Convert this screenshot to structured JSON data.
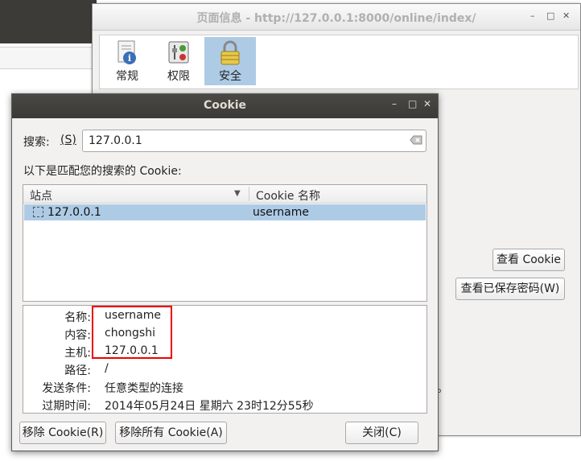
{
  "pageinfo": {
    "title": "页面信息 - http://127.0.0.1:8000/online/index/",
    "tabs": [
      {
        "label": "常规",
        "icon": "info-icon"
      },
      {
        "label": "权限",
        "icon": "permissions-icon"
      },
      {
        "label": "安全",
        "icon": "lock-icon"
      }
    ],
    "active_tab": "安全",
    "view_cookies_button": "查看 Cookie",
    "view_passwords_button": "查看已保存密码(W)",
    "partial_text": "。"
  },
  "cookie_dialog": {
    "title": "Cookie",
    "search_label": "搜索:",
    "search_accel": "(S)",
    "search_value": "127.0.0.1",
    "match_text": "以下是匹配您的搜索的 Cookie:",
    "columns": [
      "站点",
      "Cookie 名称"
    ],
    "rows": [
      {
        "site": "127.0.0.1",
        "name": "username"
      }
    ],
    "details": [
      {
        "label": "名称:",
        "value": "username"
      },
      {
        "label": "内容:",
        "value": "chongshi"
      },
      {
        "label": "主机:",
        "value": "127.0.0.1"
      },
      {
        "label": "路径:",
        "value": "/"
      },
      {
        "label": "发送条件:",
        "value": "任意类型的连接"
      },
      {
        "label": "过期时间:",
        "value": "2014年05月24日 星期六 23时12分55秒"
      }
    ],
    "buttons": {
      "remove": "移除 Cookie(R)",
      "remove_all": "移除所有 Cookie(A)",
      "close": "关闭(C)"
    }
  },
  "colors": {
    "selection": "#aecbe6",
    "dialog_titlebar": "#3c3b37",
    "highlight_box": "#ee0000"
  }
}
